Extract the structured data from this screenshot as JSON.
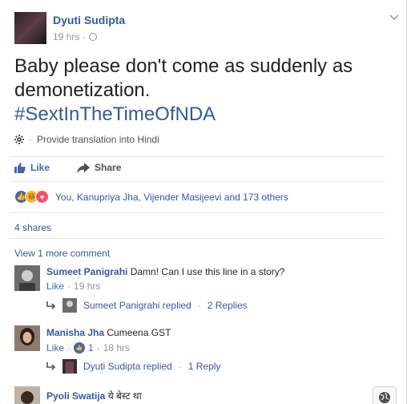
{
  "post": {
    "author": "Dyuti Sudipta",
    "time": "19 hrs",
    "text": "Baby please don't come as suddenly as demonetization.",
    "hashtag": "#SextInTheTimeOfNDA",
    "translate": "Provide translation into Hindi"
  },
  "actions": {
    "like": "Like",
    "share": "Share"
  },
  "reactions": {
    "summary": "You, Kanupriya Jha, Vijender Masijeevi and 173 others"
  },
  "shares": "4 shares",
  "view_more": "View 1 more comment",
  "comments": [
    {
      "name": "Sumeet Panigrahi",
      "text": "Damn! Can I use this line in a story?",
      "like": "Like",
      "time": "19 hrs",
      "reply": {
        "name": "Sumeet Panigrahi replied",
        "count": "2 Replies"
      }
    },
    {
      "name": "Manisha Jha",
      "text": "Cumeena GST",
      "like": "Like",
      "likes": "1",
      "time": "18 hrs",
      "reply": {
        "name": "Dyuti Sudipta replied",
        "count": "1 Reply"
      }
    },
    {
      "name": "Pyoli Swatija",
      "text": "ये बेस्ट था"
    }
  ],
  "colors": {
    "link": "#365899",
    "like_blue": "#4267b2",
    "muted": "#90949c"
  }
}
